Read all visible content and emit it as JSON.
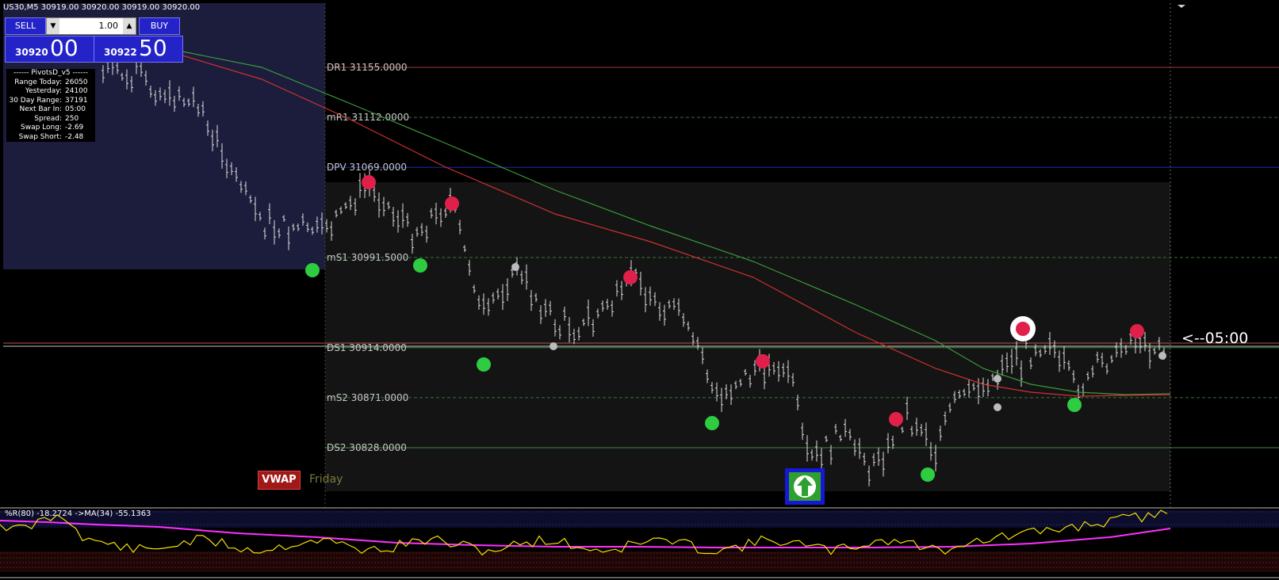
{
  "trade_panel": {
    "title": "US30,M5  30919.00 30920.00 30919.00 30920.00",
    "sell_label": "SELL",
    "buy_label": "BUY",
    "lot_value": "1.00",
    "sell_price_small": "30920",
    "sell_price_big": "00",
    "buy_price_small": "30922",
    "buy_price_big": "50"
  },
  "info_panel": {
    "header": "------ PivotsD_v5 ------",
    "rows": [
      {
        "key": "Range  Today:",
        "val": "26050"
      },
      {
        "key": "Yesterday:",
        "val": "24100"
      },
      {
        "key": "30 Day Range:",
        "val": "37191"
      },
      {
        "key": "Next Bar In:",
        "val": "05:00"
      },
      {
        "key": "Spread:",
        "val": "250"
      },
      {
        "key": "Swap  Long:",
        "val": "-2.69"
      },
      {
        "key": "Swap  Short:",
        "val": "-2.48"
      }
    ]
  },
  "pivot_levels": [
    {
      "name": "DR1",
      "price": "31155.0000",
      "color": "#a23a3a",
      "style": "solid"
    },
    {
      "name": "mR1",
      "price": "31112.0000",
      "color": "#3c6e3c",
      "style": "dashed"
    },
    {
      "name": "DPV",
      "price": "31069.0000",
      "color": "#1a2ca8",
      "style": "solid"
    },
    {
      "name": "mS1",
      "price": "30991.5000",
      "color": "#3c6e3c",
      "style": "dashed"
    },
    {
      "name": "DS1",
      "price": "30914.0000",
      "color": "#3c8a3c",
      "style": "solid"
    },
    {
      "name": "mS2",
      "price": "30871.0000",
      "color": "#3c6e3c",
      "style": "dashed"
    },
    {
      "name": "DS2",
      "price": "30828.0000",
      "color": "#3c8a3c",
      "style": "solid"
    }
  ],
  "countdown": "<--05:00",
  "vwap_label": "VWAP",
  "day_label": "Friday",
  "oscillator_label": "%R(80) -18.2724  ->MA(34) -55.1363",
  "colors": {
    "background": "#000000",
    "ma_fast": "#d03030",
    "ma_slow": "#3a9a3a",
    "swing_high": "#e0204a",
    "swing_low": "#2ecc40",
    "williams_r": "#f5e000",
    "williams_ma": "#ff30ff"
  },
  "icons": {
    "arrow_signal": "up-arrow-icon"
  }
}
